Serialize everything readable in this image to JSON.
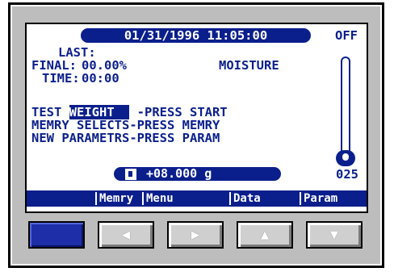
{
  "screen": {
    "date_time": "01/31/1996 11:05:00",
    "status": "OFF",
    "last_label": "LAST:",
    "final_label": "FINAL:",
    "final_value": "00.00%",
    "moisture_label": "MOISTURE",
    "time_label": "TIME:",
    "time_value": "00:00",
    "test_prefix": "TEST ",
    "test_highlight": "WEIGHT  ",
    "test_suffix": " -PRESS START",
    "line_memry": "MEMRY SELECTS-PRESS MEMRY",
    "line_param": "NEW PARAMETRS-PRESS PARAM",
    "weight_value": "+08.000 g",
    "temperature": "025"
  },
  "softkeys": [
    "Memry",
    "Menu",
    "Data",
    "Param"
  ],
  "keypad": [
    {
      "icon": "blank-key-icon",
      "glyph": ""
    },
    {
      "icon": "left-arrow-icon",
      "glyph": "◀"
    },
    {
      "icon": "right-arrow-icon",
      "glyph": "▶"
    },
    {
      "icon": "up-arrow-icon",
      "glyph": "▲"
    },
    {
      "icon": "down-arrow-icon",
      "glyph": "▼"
    }
  ],
  "colors": {
    "lcd_blue": "#0b1f8c",
    "bezel_gray": "#bdbdbd"
  }
}
